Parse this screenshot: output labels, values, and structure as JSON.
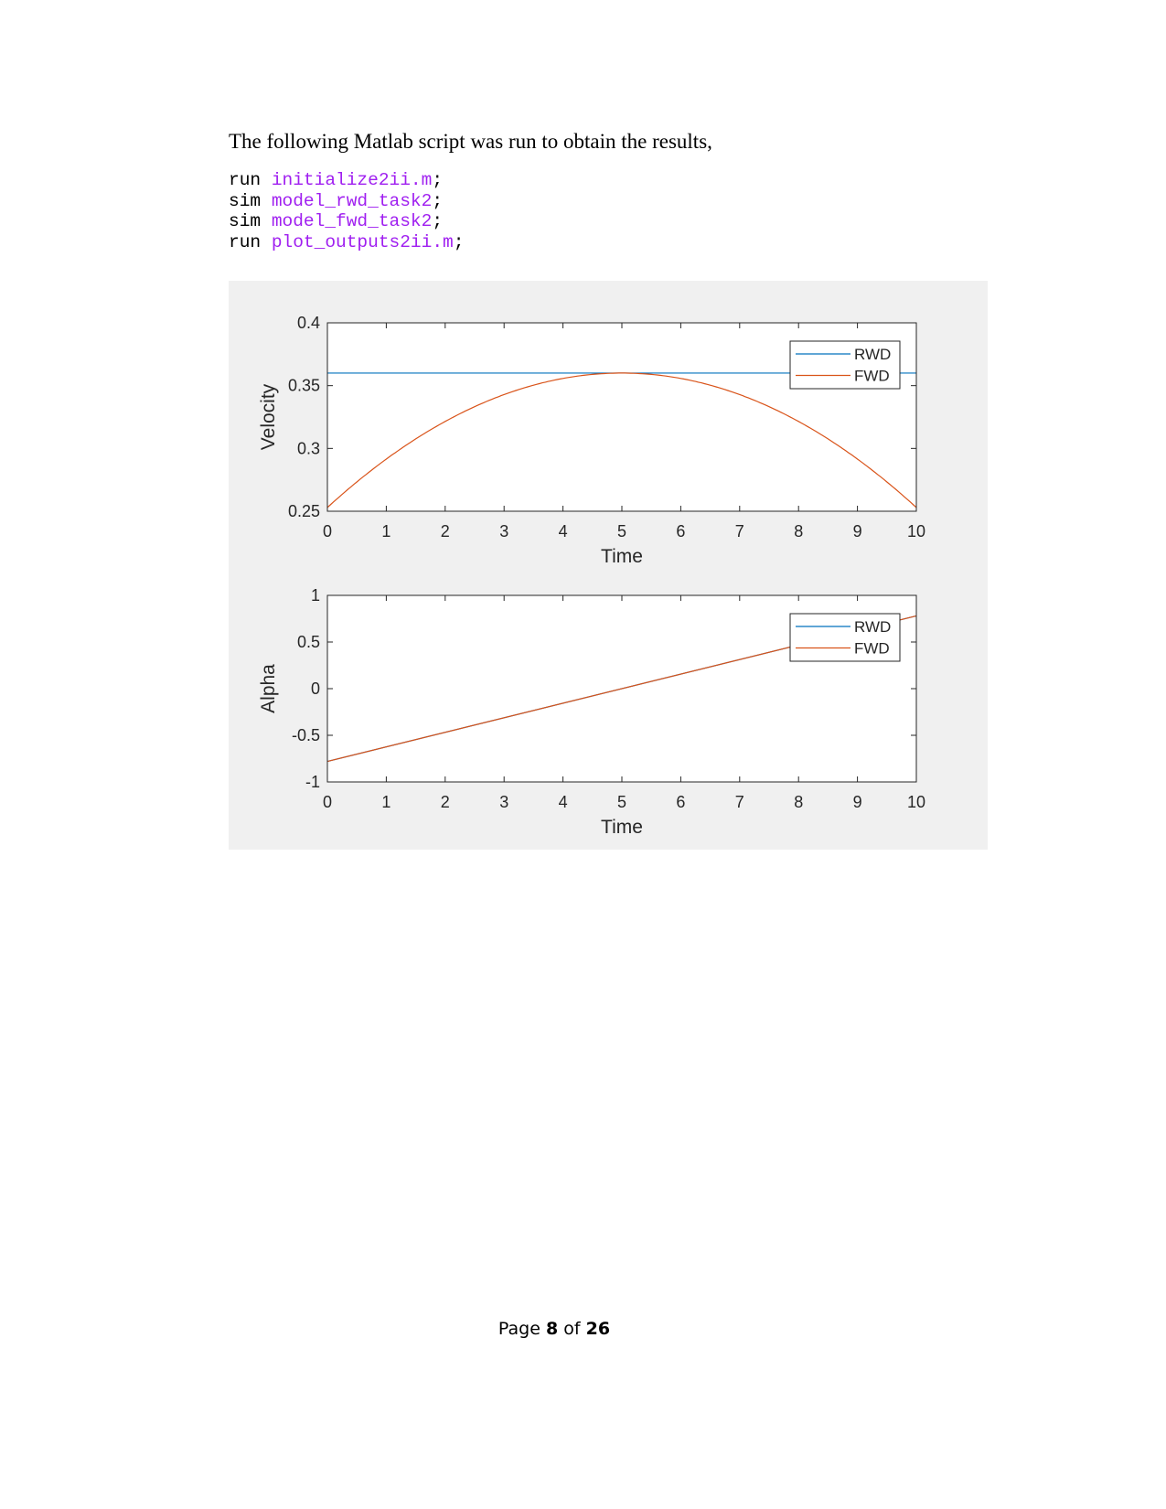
{
  "intro_text": "The following Matlab script was run to obtain the results,",
  "code_lines": [
    {
      "cmd": "run",
      "arg": "initialize2ii.m",
      "end": ";"
    },
    {
      "cmd": "sim",
      "arg": "model_rwd_task2",
      "end": ";"
    },
    {
      "cmd": "sim",
      "arg": "model_fwd_task2",
      "end": ";"
    },
    {
      "cmd": "run",
      "arg": "plot_outputs2ii.m",
      "end": ";"
    }
  ],
  "colors": {
    "code_arg": "#a020f0",
    "rwd": "#0072bd",
    "fwd": "#d95319",
    "figure_bg": "#f0f0f0"
  },
  "footer": {
    "prefix": "Page",
    "page": "8",
    "of": "of",
    "total": "26"
  },
  "chart_data": [
    {
      "type": "line",
      "xlabel": "Time",
      "ylabel": "Velocity",
      "xlim": [
        0,
        10
      ],
      "ylim": [
        0.25,
        0.4
      ],
      "xticks": [
        "0",
        "1",
        "2",
        "3",
        "4",
        "5",
        "6",
        "7",
        "8",
        "9",
        "10"
      ],
      "yticks": [
        "0.25",
        "0.3",
        "0.35",
        "0.4"
      ],
      "grid": false,
      "legend_placement": "top-right",
      "series": [
        {
          "name": "RWD",
          "x": [
            0,
            10
          ],
          "y": [
            0.36,
            0.36
          ]
        },
        {
          "name": "FWD",
          "x": [
            0,
            1,
            2,
            3,
            4,
            5,
            6,
            7,
            8,
            9,
            10
          ],
          "y": [
            0.253,
            0.292,
            0.322,
            0.343,
            0.356,
            0.36,
            0.356,
            0.343,
            0.322,
            0.292,
            0.253
          ]
        }
      ]
    },
    {
      "type": "line",
      "xlabel": "Time",
      "ylabel": "Alpha",
      "xlim": [
        0,
        10
      ],
      "ylim": [
        -1,
        1
      ],
      "xticks": [
        "0",
        "1",
        "2",
        "3",
        "4",
        "5",
        "6",
        "7",
        "8",
        "9",
        "10"
      ],
      "yticks": [
        "-1",
        "-0.5",
        "0",
        "0.5",
        "1"
      ],
      "grid": false,
      "legend_placement": "top-right",
      "series": [
        {
          "name": "RWD",
          "x": [
            0,
            10
          ],
          "y": [
            -0.78,
            0.78
          ]
        },
        {
          "name": "FWD",
          "x": [
            0,
            10
          ],
          "y": [
            -0.78,
            0.78
          ]
        }
      ]
    }
  ]
}
